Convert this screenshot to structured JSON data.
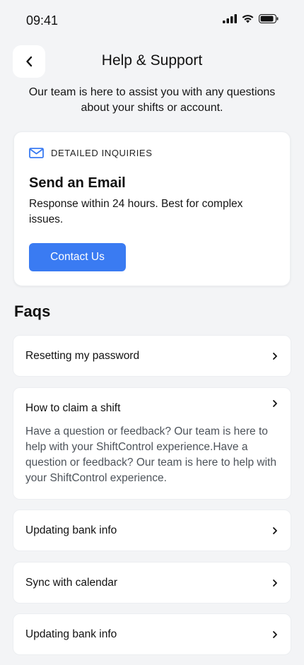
{
  "status_bar": {
    "time": "09:41"
  },
  "header": {
    "title": "Help & Support"
  },
  "intro_text": "Our team is here to assist you with any questions about your shifts or account.",
  "email_card": {
    "eyebrow": "DETAILED INQUIRIES",
    "title": "Send an Email",
    "description": "Response within 24 hours. Best for complex issues.",
    "button_label": "Contact Us"
  },
  "faqs": {
    "heading": "Faqs",
    "items": [
      {
        "question": "Resetting my password"
      },
      {
        "question": "How to claim a shift",
        "answer": "Have a question or feedback? Our team is here to help with your ShiftControl experience.Have a question or feedback? Our team is here to help with your ShiftControl experience."
      },
      {
        "question": "Updating bank info"
      },
      {
        "question": "Sync with calendar"
      },
      {
        "question": "Updating bank info"
      }
    ]
  },
  "colors": {
    "accent": "#3a7bf2",
    "background": "#f3f4f6",
    "card": "#ffffff"
  }
}
